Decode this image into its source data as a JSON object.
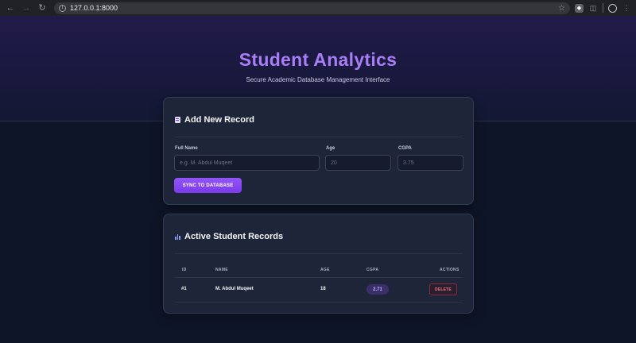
{
  "browser": {
    "url": "127.0.0.1:8000"
  },
  "header": {
    "title": "Student Analytics",
    "subtitle": "Secure Academic Database Management Interface"
  },
  "form_card": {
    "heading": "Add New Record",
    "fields": {
      "full_name": {
        "label": "Full Name",
        "value": "",
        "placeholder": "e.g. M. Abdul Muqeet"
      },
      "age": {
        "label": "Age",
        "value": "",
        "placeholder": "20"
      },
      "cgpa": {
        "label": "CGPA",
        "value": "",
        "placeholder": "3.75"
      }
    },
    "submit_label": "SYNC TO DATABASE"
  },
  "records_card": {
    "heading": "Active Student Records",
    "columns": [
      "ID",
      "NAME",
      "AGE",
      "CGPA",
      "ACTIONS"
    ],
    "rows": [
      {
        "id": "#1",
        "name": "M. Abdul Muqeet",
        "age": "18",
        "cgpa": "2.71",
        "action": "DELETE"
      }
    ]
  },
  "colors": {
    "accent": "#7c3aed",
    "title": "#a87df5",
    "danger": "#f07089"
  }
}
